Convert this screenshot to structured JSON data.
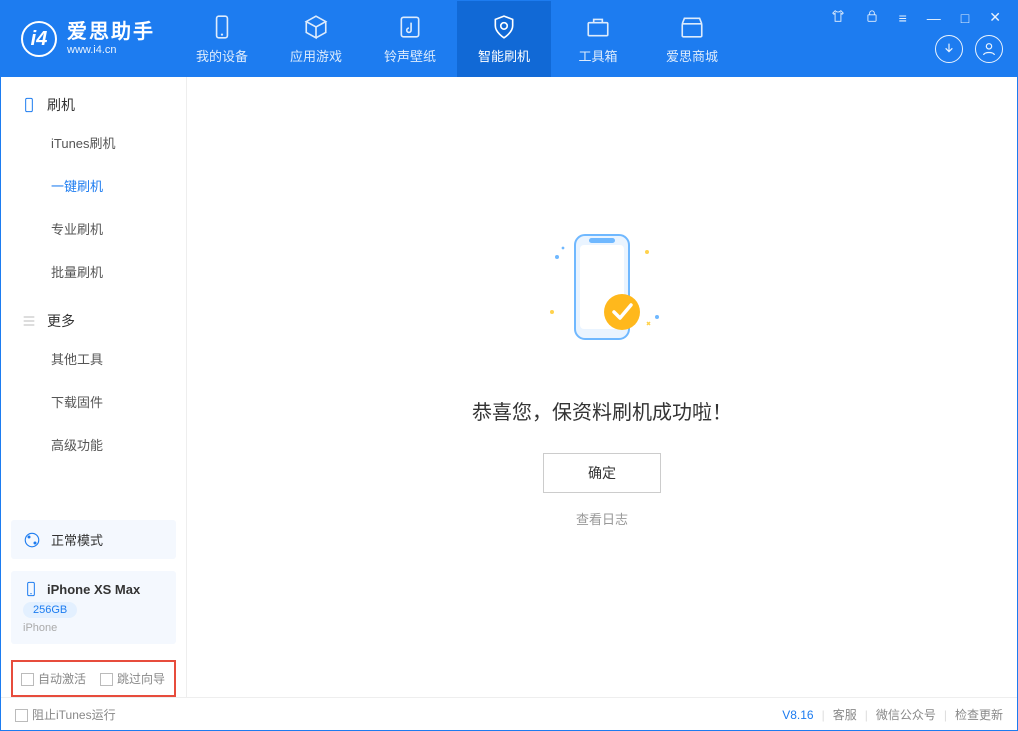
{
  "header": {
    "logo_title": "爱思助手",
    "logo_sub": "www.i4.cn",
    "tabs": [
      "我的设备",
      "应用游戏",
      "铃声壁纸",
      "智能刷机",
      "工具箱",
      "爱思商城"
    ],
    "active_tab": 3
  },
  "sidebar": {
    "section1": "刷机",
    "items1": [
      "iTunes刷机",
      "一键刷机",
      "专业刷机",
      "批量刷机"
    ],
    "active1": 1,
    "section2": "更多",
    "items2": [
      "其他工具",
      "下载固件",
      "高级功能"
    ],
    "mode_label": "正常模式",
    "device_name": "iPhone XS Max",
    "device_storage": "256GB",
    "device_brand": "iPhone",
    "check1": "自动激活",
    "check2": "跳过向导"
  },
  "main": {
    "success_text": "恭喜您，保资料刷机成功啦！",
    "ok_label": "确定",
    "log_link": "查看日志"
  },
  "statusbar": {
    "left_check": "阻止iTunes运行",
    "version": "V8.16",
    "links": [
      "客服",
      "微信公众号",
      "检查更新"
    ]
  }
}
